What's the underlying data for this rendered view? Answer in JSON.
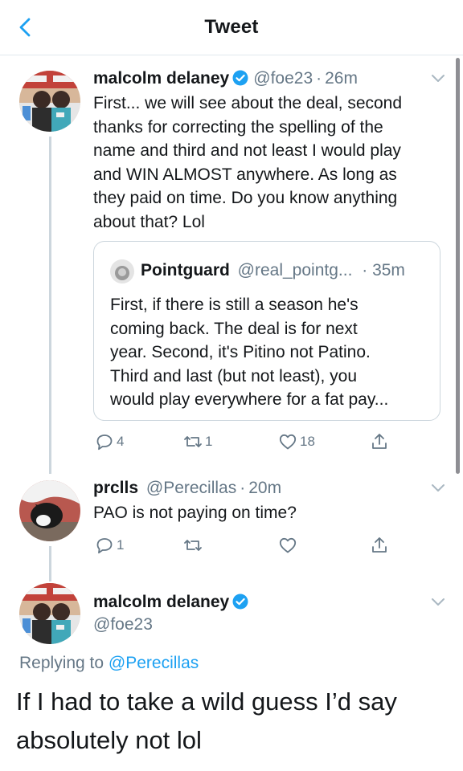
{
  "header": {
    "title": "Tweet"
  },
  "tweet1": {
    "name": "malcolm delaney",
    "handle": "@foe23",
    "sep": "·",
    "time": "26m",
    "lines": [
      "First... we will see about the deal, second",
      "thanks for correcting the spelling of the",
      "name and third and not least I would play",
      "and WIN ALMOST anywhere. As long as",
      "they paid on time. Do you know anything",
      "about that? Lol"
    ],
    "quote": {
      "name": "Pointguard",
      "handle": "@real_pointg...",
      "time": "· 35m",
      "lines": [
        "First, if there is still a season he's",
        "coming back. The deal is for next",
        "year. Second, it's Pitino not Patino.",
        "Third and last (but not least), you",
        "would play everywhere for a fat pay..."
      ]
    },
    "actions": {
      "replies": "4",
      "retweets": "1",
      "likes": "18"
    }
  },
  "tweet2": {
    "name": "prclls",
    "handle": "@Perecillas",
    "sep": "·",
    "time": "20m",
    "text": "PAO is not paying on time?",
    "actions": {
      "replies": "1"
    }
  },
  "main_tweet": {
    "name": "malcolm delaney",
    "handle": "@foe23",
    "replying_prefix": "Replying to",
    "replying_handle": "@Perecillas",
    "lines": [
      "If I had to take a wild guess I’d say",
      "absolutely not lol"
    ]
  },
  "colors": {
    "accent": "#1da1f2",
    "muted": "#657786",
    "border": "#ccd6dd"
  },
  "icons": [
    "back-arrow-icon",
    "verified-badge-icon",
    "chevron-down-icon",
    "reply-icon",
    "retweet-icon",
    "like-icon",
    "share-icon"
  ]
}
